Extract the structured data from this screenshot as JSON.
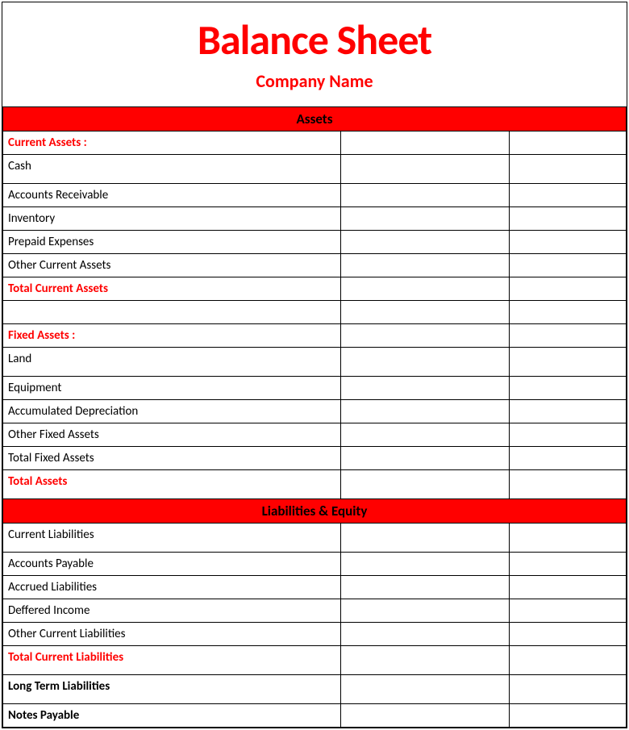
{
  "title": "Balance Sheet",
  "company_name": "Company Name",
  "section_assets": "Assets",
  "section_liabilities": "Liabilities & Equity",
  "rows": {
    "ca_header": "Current Assets :",
    "cash": "Cash",
    "ar": "Accounts Receivable",
    "inventory": "Inventory",
    "prepaid": "Prepaid Expenses",
    "other_ca": "Other Current Assets",
    "total_ca": "Total Current Assets",
    "fa_header": "Fixed Assets :",
    "land": "Land",
    "equipment": "Equipment",
    "acc_dep": "Accumulated Depreciation",
    "other_fa": "Other Fixed Assets",
    "total_fa": "Total Fixed Assets",
    "total_assets": "Total Assets",
    "cl_header": "Current Liabilities",
    "ap": "Accounts Payable",
    "accrued": "Accrued Liabilities",
    "deferred": "Deffered Income",
    "other_cl": "Other Current Liabilities",
    "total_cl": "Total Current Liabilities",
    "ltl": "Long Term Liabilities",
    "notes": "Notes Payable"
  }
}
